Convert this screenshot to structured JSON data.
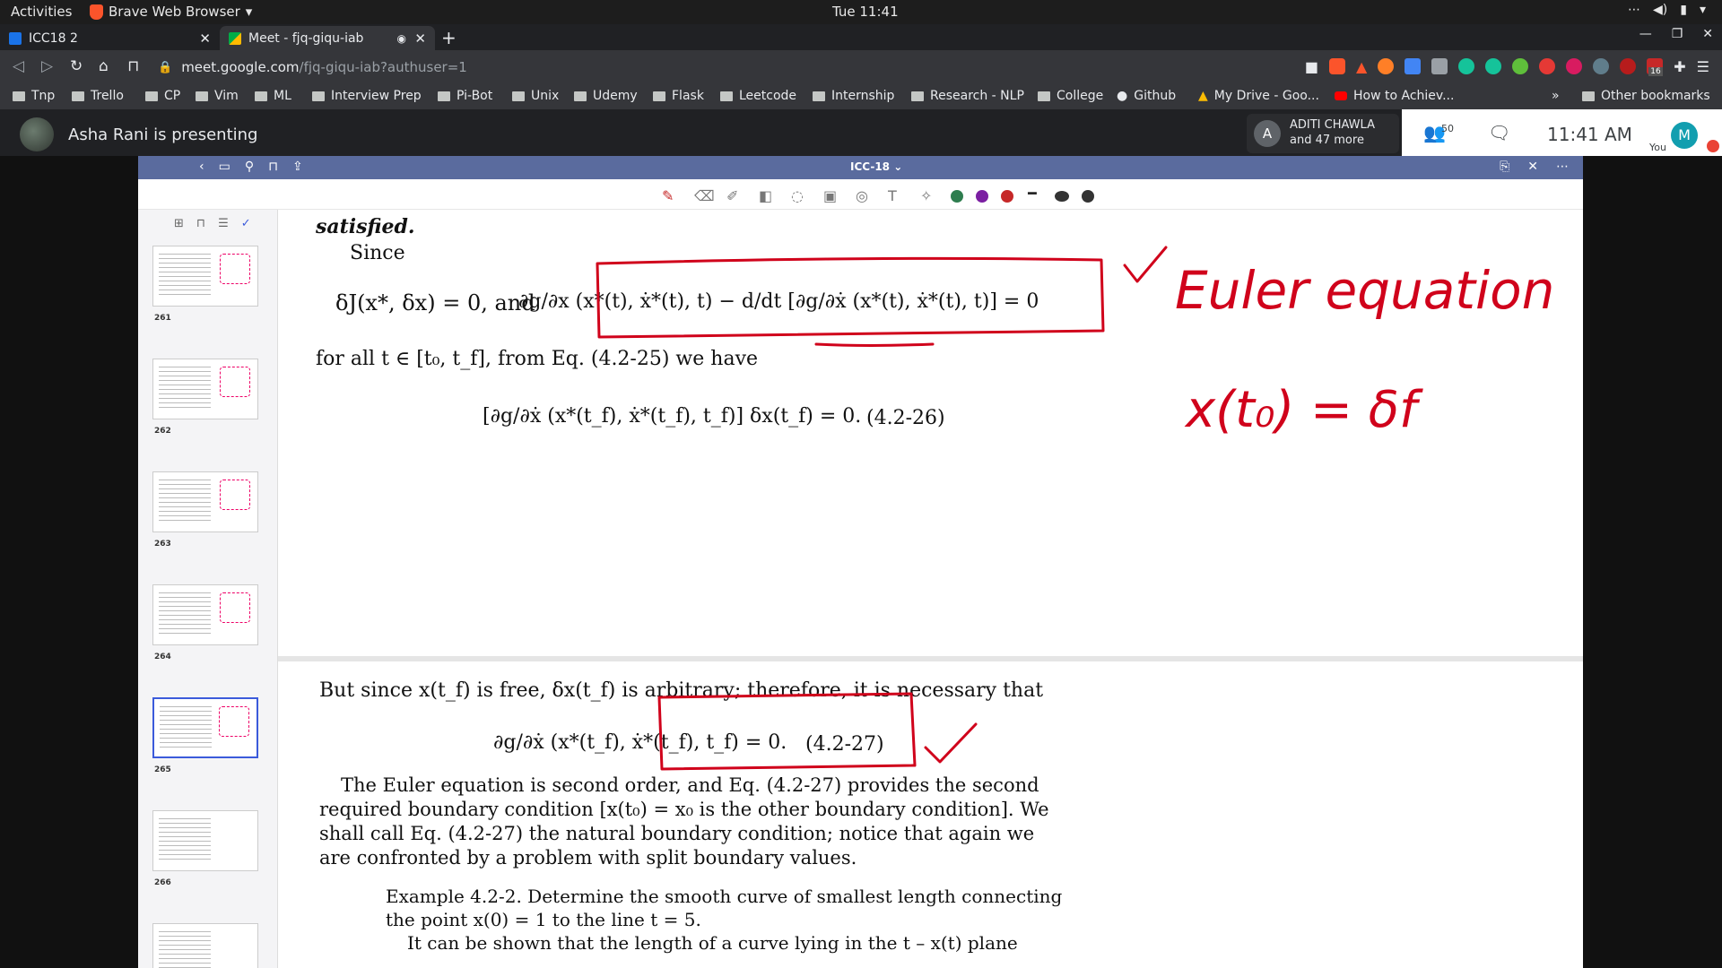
{
  "system": {
    "activities": "Activities",
    "app_name": "Brave Web Browser",
    "clock": "Tue 11:41"
  },
  "browser": {
    "tabs": [
      {
        "title": "ICC18 2"
      },
      {
        "title": "Meet - fjq-giqu-iab"
      }
    ],
    "url_host": "meet.google.com",
    "url_path": "/fjq-giqu-iab?authuser=1",
    "extension_badge": "16",
    "bookmarks": [
      "Tnp",
      "Trello",
      "CP",
      "Vim",
      "ML",
      "Interview Prep",
      "Pi-Bot",
      "Unix",
      "Udemy",
      "Flask",
      "Leetcode",
      "Internship",
      "Research - NLP",
      "College",
      "Github",
      "My Drive - Goo...",
      "How to Achiev..."
    ],
    "other_bookmarks": "Other bookmarks",
    "overflow": "»"
  },
  "meet": {
    "presenting_text": "Asha Rani is presenting",
    "participant_initial": "A",
    "participant_name": "ADITI CHAWLA",
    "participant_more": "and 47 more",
    "participant_count": "50",
    "time": "11:41  AM",
    "self_initial": "M",
    "self_label": "You"
  },
  "doc": {
    "title": "ICC-18 ⌄",
    "thumbnails": [
      {
        "page": "261"
      },
      {
        "page": "262"
      },
      {
        "page": "263"
      },
      {
        "page": "264"
      },
      {
        "page": "265"
      },
      {
        "page": "266"
      },
      {
        "page": ""
      }
    ],
    "colors": {
      "green": "#2e7d4f",
      "purple": "#7b1fa2",
      "red": "#c62828",
      "ink": "#d0021b"
    },
    "content": {
      "satisfied": "satisfied.",
      "since": "Since",
      "cond": "δJ(x*, δx) = 0,   and",
      "euler_lhs": "∂g/∂x (x*(t), ẋ*(t), t) − d/dt [∂g/∂ẋ (x*(t), ẋ*(t), t)] = 0",
      "forall": "for all t ∈ [t₀, t_f], from Eq. (4.2-25) we have",
      "eq26": "[∂g/∂ẋ (x*(t_f), ẋ*(t_f), t_f)] δx(t_f) = 0.",
      "eq26_num": "(4.2-26)",
      "butsince": "But since x(t_f) is free, δx(t_f) is arbitrary; therefore, it is necessary that",
      "eq27": "∂g/∂ẋ (x*(t_f), ẋ*(t_f), t_f) = 0.",
      "eq27_num": "(4.2-27)",
      "para1": "The Euler equation is second order, and Eq. (4.2-27) provides the second",
      "para2": "required boundary condition [x(t₀) = x₀ is the other boundary condition]. We",
      "para3": "shall call Eq. (4.2-27) the natural boundary condition; notice that again we",
      "para4": "are confronted by a problem with split boundary values.",
      "ex1": "Example 4.2-2.  Determine the smooth curve of smallest length connecting",
      "ex2": "the point x(0) = 1 to the line t = 5.",
      "ex3": "It can be shown that the length of a curve lying in the t – x(t) plane"
    },
    "handwriting": {
      "note1": "Euler equation",
      "note2": "x(t₀) = δf"
    }
  }
}
